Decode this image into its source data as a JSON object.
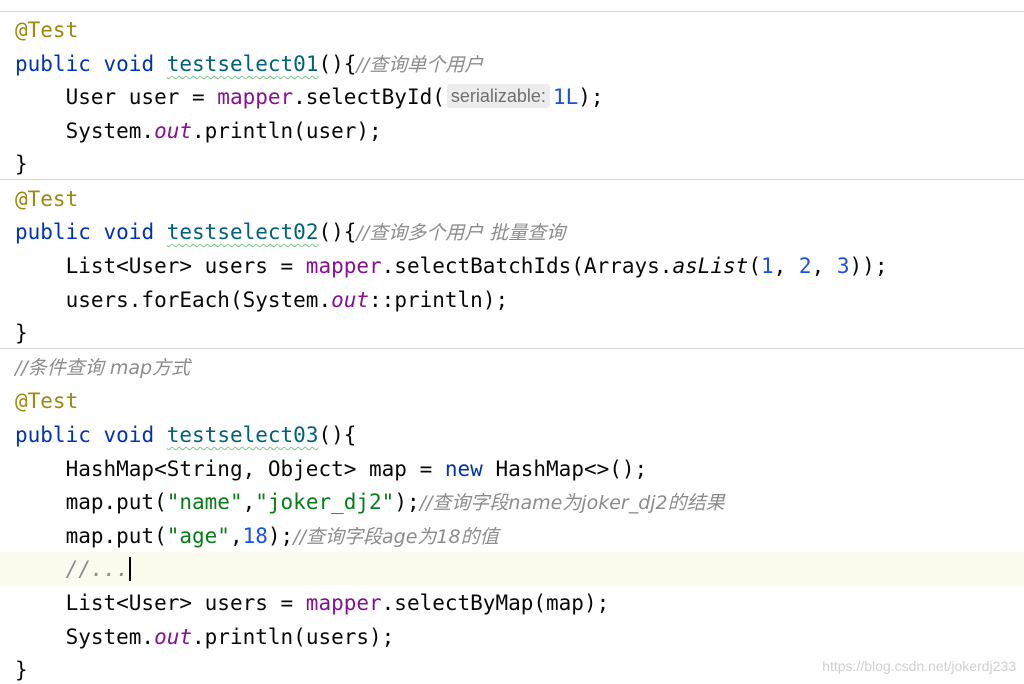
{
  "code": {
    "method1": {
      "annotation": "@Test",
      "kw_public": "public",
      "kw_void": "void",
      "name": "testselect01",
      "open": "(){",
      "comment": "//查询单个用户",
      "line2_type": "User user = ",
      "line2_mapper": "mapper",
      "line2_call": ".selectById(",
      "line2_hint": "serializable:",
      "line2_arg": "1L",
      "line2_end": ");",
      "line3_pre": "System.",
      "line3_out": "out",
      "line3_post": ".println(user);",
      "close": "}"
    },
    "method2": {
      "annotation": "@Test",
      "kw_public": "public",
      "kw_void": "void",
      "name": "testselect02",
      "open": "(){",
      "comment": "//查询多个用户 批量查询",
      "line2_type": "List<User> users = ",
      "line2_mapper": "mapper",
      "line2_call": ".selectBatchIds(Arrays.",
      "line2_aslist": "asList",
      "line2_open": "(",
      "line2_n1": "1",
      "line2_sep1": ", ",
      "line2_n2": "2",
      "line2_sep2": ", ",
      "line2_n3": "3",
      "line2_end": "));",
      "line3_pre": "users.forEach(System.",
      "line3_out": "out",
      "line3_post": "::println);",
      "close": "}"
    },
    "method3": {
      "pre_comment": "//条件查询 map方式",
      "annotation": "@Test",
      "kw_public": "public",
      "kw_void": "void",
      "name": "testselect03",
      "open": "(){",
      "line1_pre": "HashMap<String, Object> map = ",
      "line1_new": "new",
      "line1_post": " HashMap<>();",
      "line2_pre": "map.put(",
      "line2_key": "\"name\"",
      "line2_comma": ",",
      "line2_val": "\"joker_dj2\"",
      "line2_end": ");",
      "line2_comment": "//查询字段name为joker_dj2的结果",
      "line3_pre": "map.put(",
      "line3_key": "\"age\"",
      "line3_comma": ",",
      "line3_val": "18",
      "line3_end": ");",
      "line3_comment": "//查询字段age为18的值",
      "line4_comment": "//...",
      "line5_type": "List<User> users = ",
      "line5_mapper": "mapper",
      "line5_call": ".selectByMap(map);",
      "line6_pre": "System.",
      "line6_out": "out",
      "line6_post": ".println(users);",
      "close": "}"
    }
  },
  "watermark": "https://blog.csdn.net/jokerdj233",
  "colors": {
    "annotation": "#9e880d",
    "keyword": "#0033b3",
    "method_name": "#00627a",
    "field": "#871094",
    "number": "#1750eb",
    "string": "#067d17",
    "comment": "#8c8c8c",
    "current_line": "#fcfaed"
  }
}
